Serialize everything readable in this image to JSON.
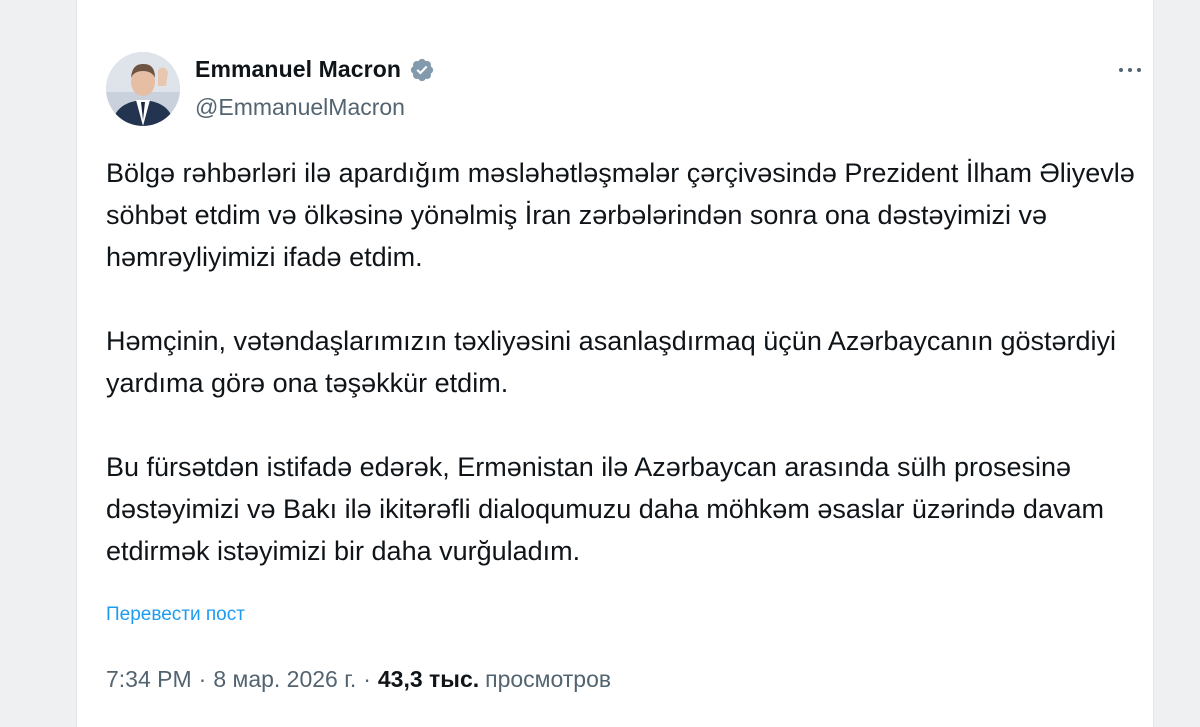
{
  "author": {
    "display_name": "Emmanuel Macron",
    "handle": "@EmmanuelMacron",
    "verified": true
  },
  "tweet": {
    "paragraphs": [
      "Bölgə rəhbərləri ilə apardığım məsləhətləşmələr çərçivəsində Prezident İlham Əliyevlə söhbət etdim və ölkəsinə yönəlmiş İran zərbələrindən sonra ona dəstəyimizi və həmrəyliyimizi ifadə etdim.",
      "Həmçinin, vətəndaşlarımızın təxliyəsini asanlaşdırmaq üçün Azərbaycanın göstərdiyi yardıma görə ona təşəkkür etdim.",
      "Bu fürsətdən istifadə edərək, Ermənistan ilə Azərbaycan arasında sülh prosesinə dəstəyimizi və Bakı ilə ikitərəfli dialoqumuzu daha möhkəm əsaslar üzərində davam etdirmək istəyimizi bir daha vurğuladım."
    ],
    "translate_link": "Перевести пост"
  },
  "meta": {
    "time": "7:34 PM",
    "separator": "·",
    "date": "8 мар. 2026 г.",
    "views_count": "43,3 тыс.",
    "views_label": "просмотров"
  },
  "icons": {
    "verified": "verified-badge-icon",
    "more": "more-options-icon"
  },
  "colors": {
    "link": "#1d9bf0",
    "secondary_text": "#536471",
    "primary_text": "#0f1419",
    "verified_badge": "#829aab"
  }
}
